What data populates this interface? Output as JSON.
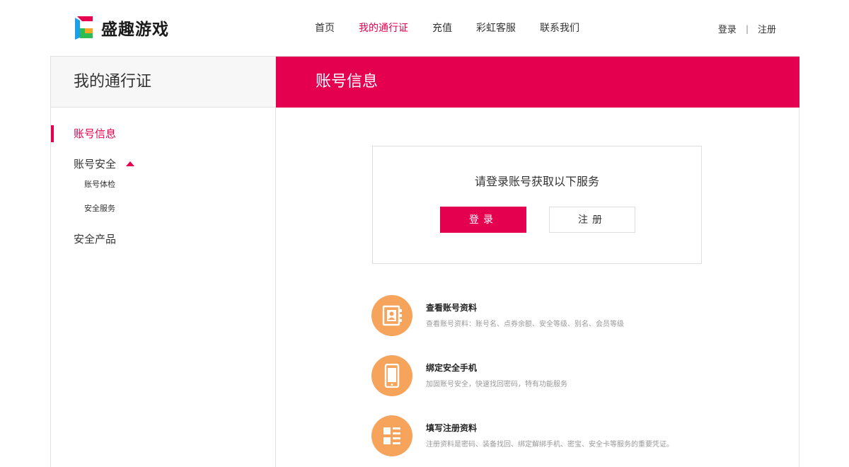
{
  "header": {
    "logo_text": "盛趣游戏",
    "nav": [
      {
        "label": "首页",
        "active": false
      },
      {
        "label": "我的通行证",
        "active": true
      },
      {
        "label": "充值",
        "active": false
      },
      {
        "label": "彩虹客服",
        "active": false
      },
      {
        "label": "联系我们",
        "active": false
      }
    ],
    "login_link": "登录",
    "separator": "|",
    "register_link": "注册"
  },
  "sidebar": {
    "title": "我的通行证",
    "items": [
      {
        "label": "账号信息",
        "active": true
      },
      {
        "label": "账号安全",
        "expanded": true,
        "children": [
          "账号体检",
          "安全服务"
        ]
      },
      {
        "label": "安全产品"
      }
    ]
  },
  "main": {
    "title": "账号信息",
    "login_box": {
      "prompt": "请登录账号获取以下服务",
      "login_button": "登录",
      "register_button": "注册"
    },
    "features": [
      {
        "icon": "contact-book-icon",
        "title": "查看账号资料",
        "desc": "查看账号资料：账号名、点券余额、安全等级、别名、会员等级"
      },
      {
        "icon": "mobile-phone-icon",
        "title": "绑定安全手机",
        "desc": "加固账号安全，快速找回密码，特有功能服务"
      },
      {
        "icon": "form-list-icon",
        "title": "填写注册资料",
        "desc": "注册资料是密码、装备找回、绑定解绑手机、密宝、安全卡等服务的重要凭证。"
      }
    ]
  },
  "colors": {
    "accent": "#e5004f",
    "feature_icon_bg": "#f6a35c",
    "sidebar_head_bg": "#f7f7f7",
    "border": "#e2e2e2"
  }
}
